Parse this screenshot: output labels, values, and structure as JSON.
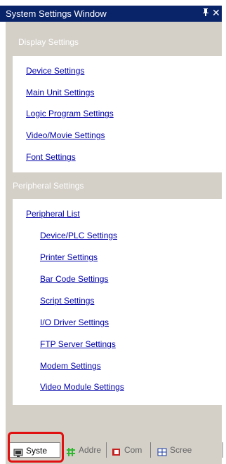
{
  "window": {
    "title": "System Settings Window",
    "pin_glyph": "4",
    "close_glyph": "✕"
  },
  "display": {
    "title": "Display Settings",
    "items": [
      "Device Settings",
      "Main Unit Settings",
      "Logic Program Settings",
      "Video/Movie Settings",
      "Font Settings"
    ]
  },
  "peripheral": {
    "title": "Peripheral Settings",
    "list_label": "Peripheral List",
    "items": [
      "Device/PLC Settings",
      "Printer Settings",
      "Bar Code Settings",
      "Script Settings",
      "I/O Driver Settings",
      "FTP Server Settings",
      "Modem Settings",
      "Video Module Settings"
    ]
  },
  "tabs": [
    {
      "label": "Syste",
      "icon": "system-settings-icon",
      "active": true
    },
    {
      "label": "Addre",
      "icon": "address-icon",
      "active": false
    },
    {
      "label": "Com",
      "icon": "common-icon",
      "active": false
    },
    {
      "label": "Scree",
      "icon": "screen-icon",
      "active": false
    }
  ],
  "colors": {
    "titlebar": "#0a246a",
    "link": "#0000aa",
    "panel_bg": "#d4d0c8",
    "highlight": "#e01010"
  }
}
